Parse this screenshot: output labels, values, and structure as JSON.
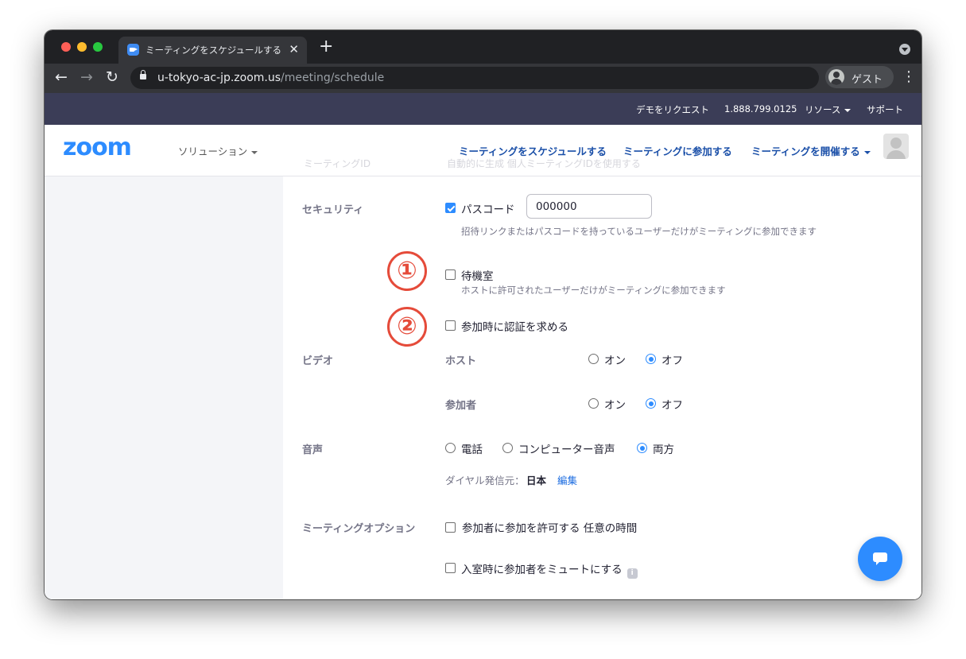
{
  "browser": {
    "tab_title": "ミーティングをスケジュールする - Zoom",
    "close_glyph": "✕",
    "new_tab_glyph": "+",
    "url_host": "u-tokyo-ac-jp.zoom.us",
    "url_path": "/meeting/schedule",
    "profile_label": "ゲスト",
    "back_glyph": "←",
    "forward_glyph": "→",
    "reload_glyph": "↻",
    "menu_glyph": "⋮"
  },
  "topbar": {
    "demo": "デモをリクエスト",
    "phone": "1.888.799.0125",
    "resources": "リソース",
    "support": "サポート"
  },
  "nav": {
    "logo": "zoom",
    "solutions": "ソリューション",
    "schedule": "ミーティングをスケジュールする",
    "join": "ミーティングに参加する",
    "host": "ミーティングを開催する",
    "ghost_label": "ミーティングID",
    "ghost_text": "自動的に生成 個人ミーティングIDを使用する"
  },
  "security": {
    "label": "セキュリティ",
    "passcode_label": "パスコード",
    "passcode_value": "000000",
    "passcode_checked": true,
    "passcode_hint": "招待リンクまたはパスコードを持っているユーザーだけがミーティングに参加できます",
    "waiting_room_label": "待機室",
    "waiting_room_hint": "ホストに許可されたユーザーだけがミーティングに参加できます",
    "auth_label": "参加時に認証を求める"
  },
  "markers": [
    "①",
    "②"
  ],
  "video": {
    "label": "ビデオ",
    "host_label": "ホスト",
    "participant_label": "参加者",
    "on": "オン",
    "off": "オフ",
    "host_value": "オフ",
    "participant_value": "オフ"
  },
  "audio": {
    "label": "音声",
    "phone": "電話",
    "computer": "コンピューター音声",
    "both": "両方",
    "selected": "両方",
    "dial_from_label": "ダイヤル発信元：",
    "dial_from_value": "日本",
    "edit": "編集"
  },
  "meeting_options": {
    "label": "ミーティングオプション",
    "join_before_host": "参加者に参加を許可する 任意の時間",
    "mute_on_entry": "入室時に参加者をミュートにする",
    "info_glyph": "i"
  },
  "colors": {
    "accent": "#2d8cff",
    "link": "#1a4fa8",
    "marker": "#e54b3a",
    "topbar": "#3b3d57"
  }
}
